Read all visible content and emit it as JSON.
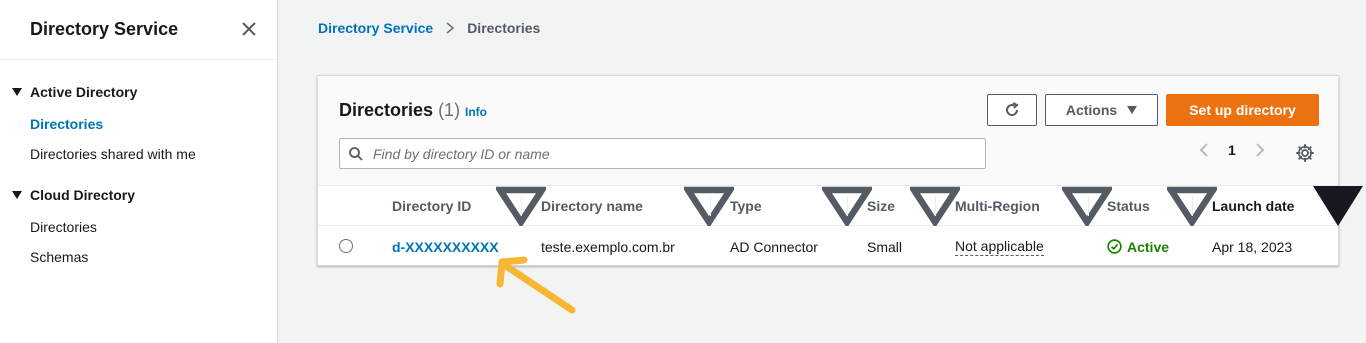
{
  "sidebar": {
    "title": "Directory Service",
    "sections": [
      {
        "label": "Active Directory",
        "items": [
          "Directories",
          "Directories shared with me"
        ]
      },
      {
        "label": "Cloud Directory",
        "items": [
          "Directories",
          "Schemas"
        ]
      }
    ]
  },
  "breadcrumb": {
    "parent": "Directory Service",
    "current": "Directories"
  },
  "panel": {
    "title": "Directories",
    "count": "(1)",
    "info": "Info",
    "actions_label": "Actions",
    "primary_label": "Set up directory",
    "search_placeholder": "Find by directory ID or name",
    "page": "1"
  },
  "table": {
    "columns": [
      "Directory ID",
      "Directory name",
      "Type",
      "Size",
      "Multi-Region",
      "Status",
      "Launch date"
    ],
    "rows": [
      {
        "directory_id": "d-XXXXXXXXXX",
        "directory_name": "teste.exemplo.com.br",
        "type": "AD Connector",
        "size": "Small",
        "multi_region": "Not applicable",
        "status": "Active",
        "launch_date": "Apr 18, 2023"
      }
    ]
  },
  "colors": {
    "link": "#0073bb",
    "primary": "#ec7211",
    "success": "#1d8102",
    "annotation_arrow": "#f7b733"
  }
}
